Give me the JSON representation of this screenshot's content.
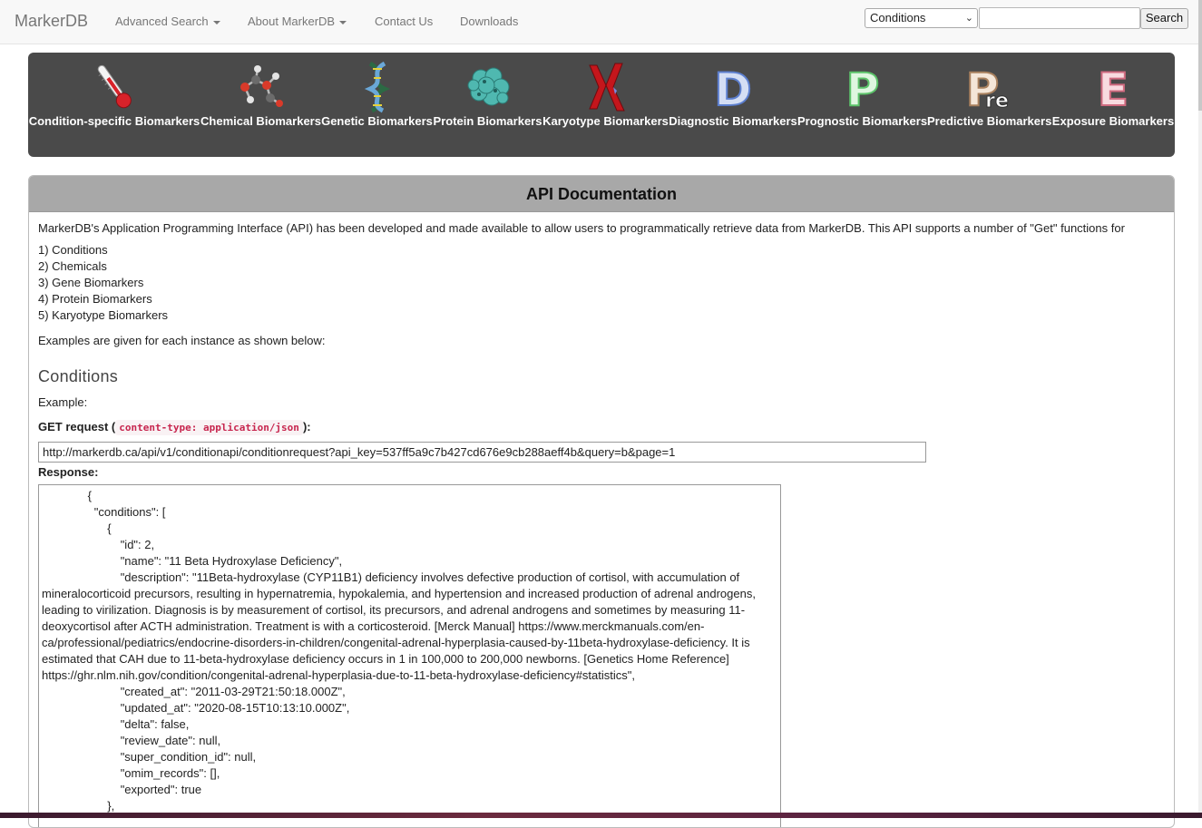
{
  "navbar": {
    "brand": "MarkerDB",
    "items": [
      {
        "label": "Advanced Search",
        "dropdown": true
      },
      {
        "label": "About MarkerDB",
        "dropdown": true
      },
      {
        "label": "Contact Us",
        "dropdown": false
      },
      {
        "label": "Downloads",
        "dropdown": false
      }
    ],
    "search": {
      "select_value": "Conditions",
      "input_value": "",
      "button_label": "Search"
    }
  },
  "categories": [
    {
      "label": "Condition-specific Biomarkers",
      "icon": "thermometer-icon"
    },
    {
      "label": "Chemical Biomarkers",
      "icon": "molecule-icon"
    },
    {
      "label": "Genetic Biomarkers",
      "icon": "dna-icon"
    },
    {
      "label": "Protein Biomarkers",
      "icon": "protein-icon"
    },
    {
      "label": "Karyotype Biomarkers",
      "icon": "chromosome-icon"
    },
    {
      "label": "Diagnostic Biomarkers",
      "icon": "letter-d-icon",
      "letter": "D",
      "color": "#6a8fd4"
    },
    {
      "label": "Prognostic Biomarkers",
      "icon": "letter-p-icon",
      "letter": "P",
      "color": "#7bd686"
    },
    {
      "label": "Predictive Biomarkers",
      "icon": "letter-pre-icon",
      "letter": "P",
      "sub": "re",
      "color": "#c9a88a"
    },
    {
      "label": "Exposure Biomarkers",
      "icon": "letter-e-icon",
      "letter": "E",
      "color": "#e08a9a"
    }
  ],
  "panel": {
    "title": "API Documentation",
    "intro": "MarkerDB's Application Programming Interface (API) has been developed and made available to allow users to programmatically retrieve data from MarkerDB. This API supports a number of \"Get\" functions for",
    "list": [
      "1) Conditions",
      "2) Chemicals",
      "3) Gene Biomarkers",
      "4) Protein Biomarkers",
      "5) Karyotype Biomarkers"
    ],
    "examples_text": "Examples are given for each instance as shown below:",
    "section_title": "Conditions",
    "example_label": "Example:",
    "get_request_prefix": "GET request (",
    "get_request_code": "content-type: application/json",
    "get_request_suffix": "):",
    "url": "http://markerdb.ca/api/v1/conditionapi/conditionrequest?api_key=537ff5a9c7b427cd676e9cb288aeff4b&query=b&page=1",
    "response_label": "Response:",
    "response_lines": [
      "              {",
      "                \"conditions\": [",
      "                    {",
      "                        \"id\": 2,",
      "                        \"name\": \"11 Beta Hydroxylase Deficiency\",",
      "                        \"description\": \"11Beta-hydroxylase (CYP11B1) deficiency involves defective production of cortisol, with accumulation of mineralocorticoid precursors, resulting in hypernatremia, hypokalemia, and hypertension and increased production of adrenal androgens, leading to virilization. Diagnosis is by measurement of cortisol, its precursors, and adrenal androgens and sometimes by measuring 11-deoxycortisol after ACTH administration. Treatment is with a corticosteroid. [Merck Manual] https://www.merckmanuals.com/en-ca/professional/pediatrics/endocrine-disorders-in-children/congenital-adrenal-hyperplasia-caused-by-11beta-hydroxylase-deficiency. It is estimated that CAH due to 11-beta-hydroxylase deficiency occurs in 1 in 100,000 to 200,000 newborns. [Genetics Home Reference] https://ghr.nlm.nih.gov/condition/congenital-adrenal-hyperplasia-due-to-11-beta-hydroxylase-deficiency#statistics\",",
      "                        \"created_at\": \"2011-03-29T21:50:18.000Z\",",
      "                        \"updated_at\": \"2020-08-15T10:13:10.000Z\",",
      "                        \"delta\": false,",
      "                        \"review_date\": null,",
      "                        \"super_condition_id\": null,",
      "                        \"omim_records\": [],",
      "                        \"exported\": true",
      "                    },"
    ]
  }
}
